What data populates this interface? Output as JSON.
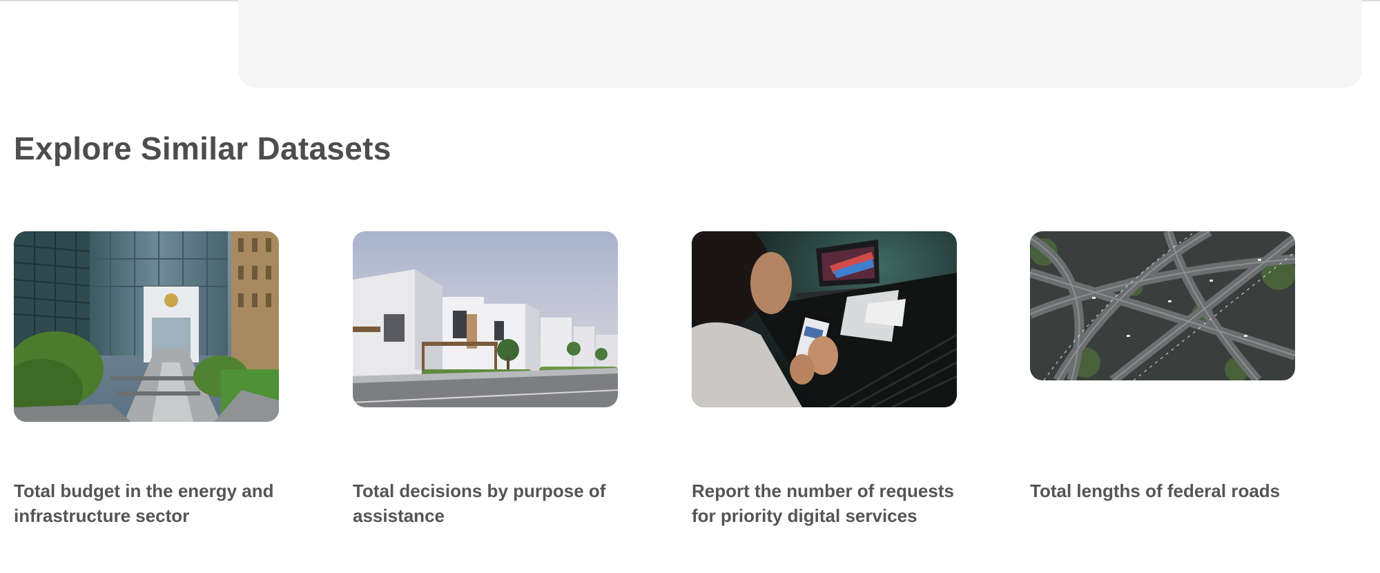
{
  "section": {
    "title": "Explore Similar Datasets"
  },
  "cards": [
    {
      "title": "Total budget in the energy and infrastructure sector",
      "image": "government-building-photo"
    },
    {
      "title": "Total decisions by purpose of assistance",
      "image": "villas-housing-photo"
    },
    {
      "title": "Report the number of requests for priority digital services",
      "image": "person-using-phone-photo"
    },
    {
      "title": "Total lengths of federal roads",
      "image": "highway-interchange-aerial-photo"
    }
  ]
}
